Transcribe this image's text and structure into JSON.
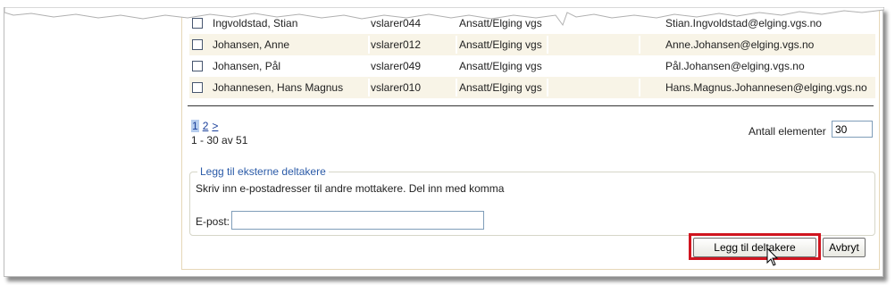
{
  "rows": [
    {
      "name": "Ingvoldstad, Stian",
      "username": "vslarer044",
      "org": "Ansatt/Elging vgs",
      "email": "Stian.Ingvoldstad@elging.vgs.no"
    },
    {
      "name": "Johansen, Anne",
      "username": "vslarer012",
      "org": "Ansatt/Elging vgs",
      "email": "Anne.Johansen@elging.vgs.no"
    },
    {
      "name": "Johansen, Pål",
      "username": "vslarer049",
      "org": "Ansatt/Elging vgs",
      "email": "Pål.Johansen@elging.vgs.no"
    },
    {
      "name": "Johannesen, Hans Magnus",
      "username": "vslarer010",
      "org": "Ansatt/Elging vgs",
      "email": "Hans.Magnus.Johannesen@elging.vgs.no"
    }
  ],
  "pagination": {
    "page1": "1",
    "page2": "2",
    "next": ">",
    "summary": "1 - 30 av 51"
  },
  "page_size": {
    "label": "Antall elementer",
    "value": "30"
  },
  "external": {
    "legend": "Legg til eksterne deltakere",
    "hint": "Skriv inn e-postadresser til andre mottakere. Del inn med komma",
    "email_label": "E-post:",
    "email_value": ""
  },
  "buttons": {
    "add": "Legg til deltakere",
    "cancel": "Avbryt"
  },
  "colors": {
    "alt_row": "#f8f4e7",
    "panel_border": "#e6d7b8",
    "highlight": "#d0151f",
    "link": "#1a3f9a"
  }
}
